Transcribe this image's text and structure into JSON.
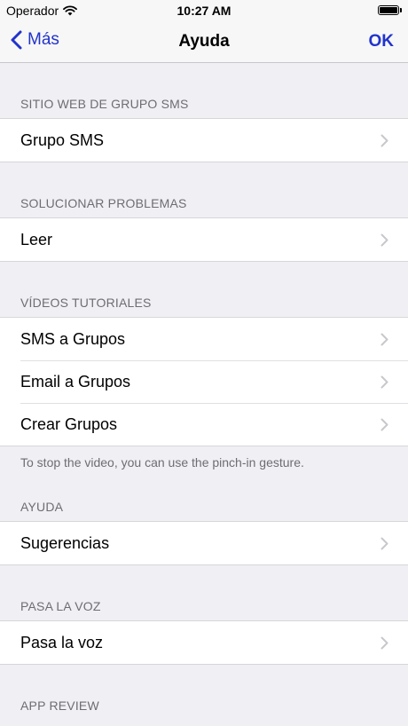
{
  "status_bar": {
    "carrier": "Operador",
    "time": "10:27 AM"
  },
  "nav": {
    "back_label": "Más",
    "title": "Ayuda",
    "done_label": "OK"
  },
  "sections": {
    "website": {
      "header": "SITIO WEB DE GRUPO SMS",
      "items": [
        "Grupo SMS"
      ]
    },
    "troubleshoot": {
      "header": "SOLUCIONAR PROBLEMAS",
      "items": [
        "Leer"
      ]
    },
    "videos": {
      "header": "VÍDEOS TUTORIALES",
      "items": [
        "SMS a Grupos",
        "Email a Grupos",
        "Crear Grupos"
      ],
      "footer": "To stop the video, you can use the pinch-in gesture."
    },
    "help": {
      "header": "AYUDA",
      "items": [
        "Sugerencias"
      ]
    },
    "share": {
      "header": "PASA LA VOZ",
      "items": [
        "Pasa la voz"
      ]
    },
    "review": {
      "header": "APP REVIEW"
    }
  },
  "icons": {
    "back": "chevron-left-icon",
    "row_disclosure": "chevron-right-icon",
    "wifi": "wifi-icon",
    "battery": "battery-icon"
  },
  "colors": {
    "tint": "#2233cc",
    "background": "#efeff4",
    "header_text": "#6d6d72"
  }
}
